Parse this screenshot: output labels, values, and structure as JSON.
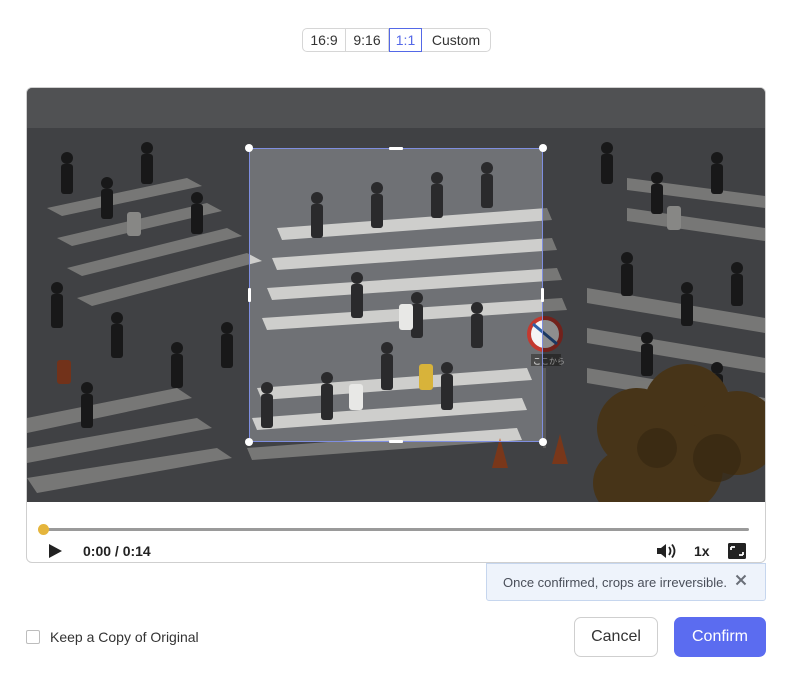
{
  "aspect_ratios": [
    "16:9",
    "9:16",
    "1:1",
    "Custom"
  ],
  "selected_ratio": "1:1",
  "player": {
    "time_display": "0:00 / 0:14",
    "speed": "1x",
    "progress": 0
  },
  "video_sign_text": "ここから",
  "notice": {
    "text": "Once confirmed, crops are irreversible."
  },
  "keep_copy": {
    "label": "Keep a Copy of Original",
    "checked": false
  },
  "buttons": {
    "cancel": "Cancel",
    "confirm": "Confirm"
  },
  "colors": {
    "accent": "#5b6cf0",
    "progress_thumb": "#e5b53c",
    "notice_bg": "#eef3fb"
  },
  "icons": [
    "play-icon",
    "volume-icon",
    "fullscreen-icon",
    "close-icon"
  ]
}
